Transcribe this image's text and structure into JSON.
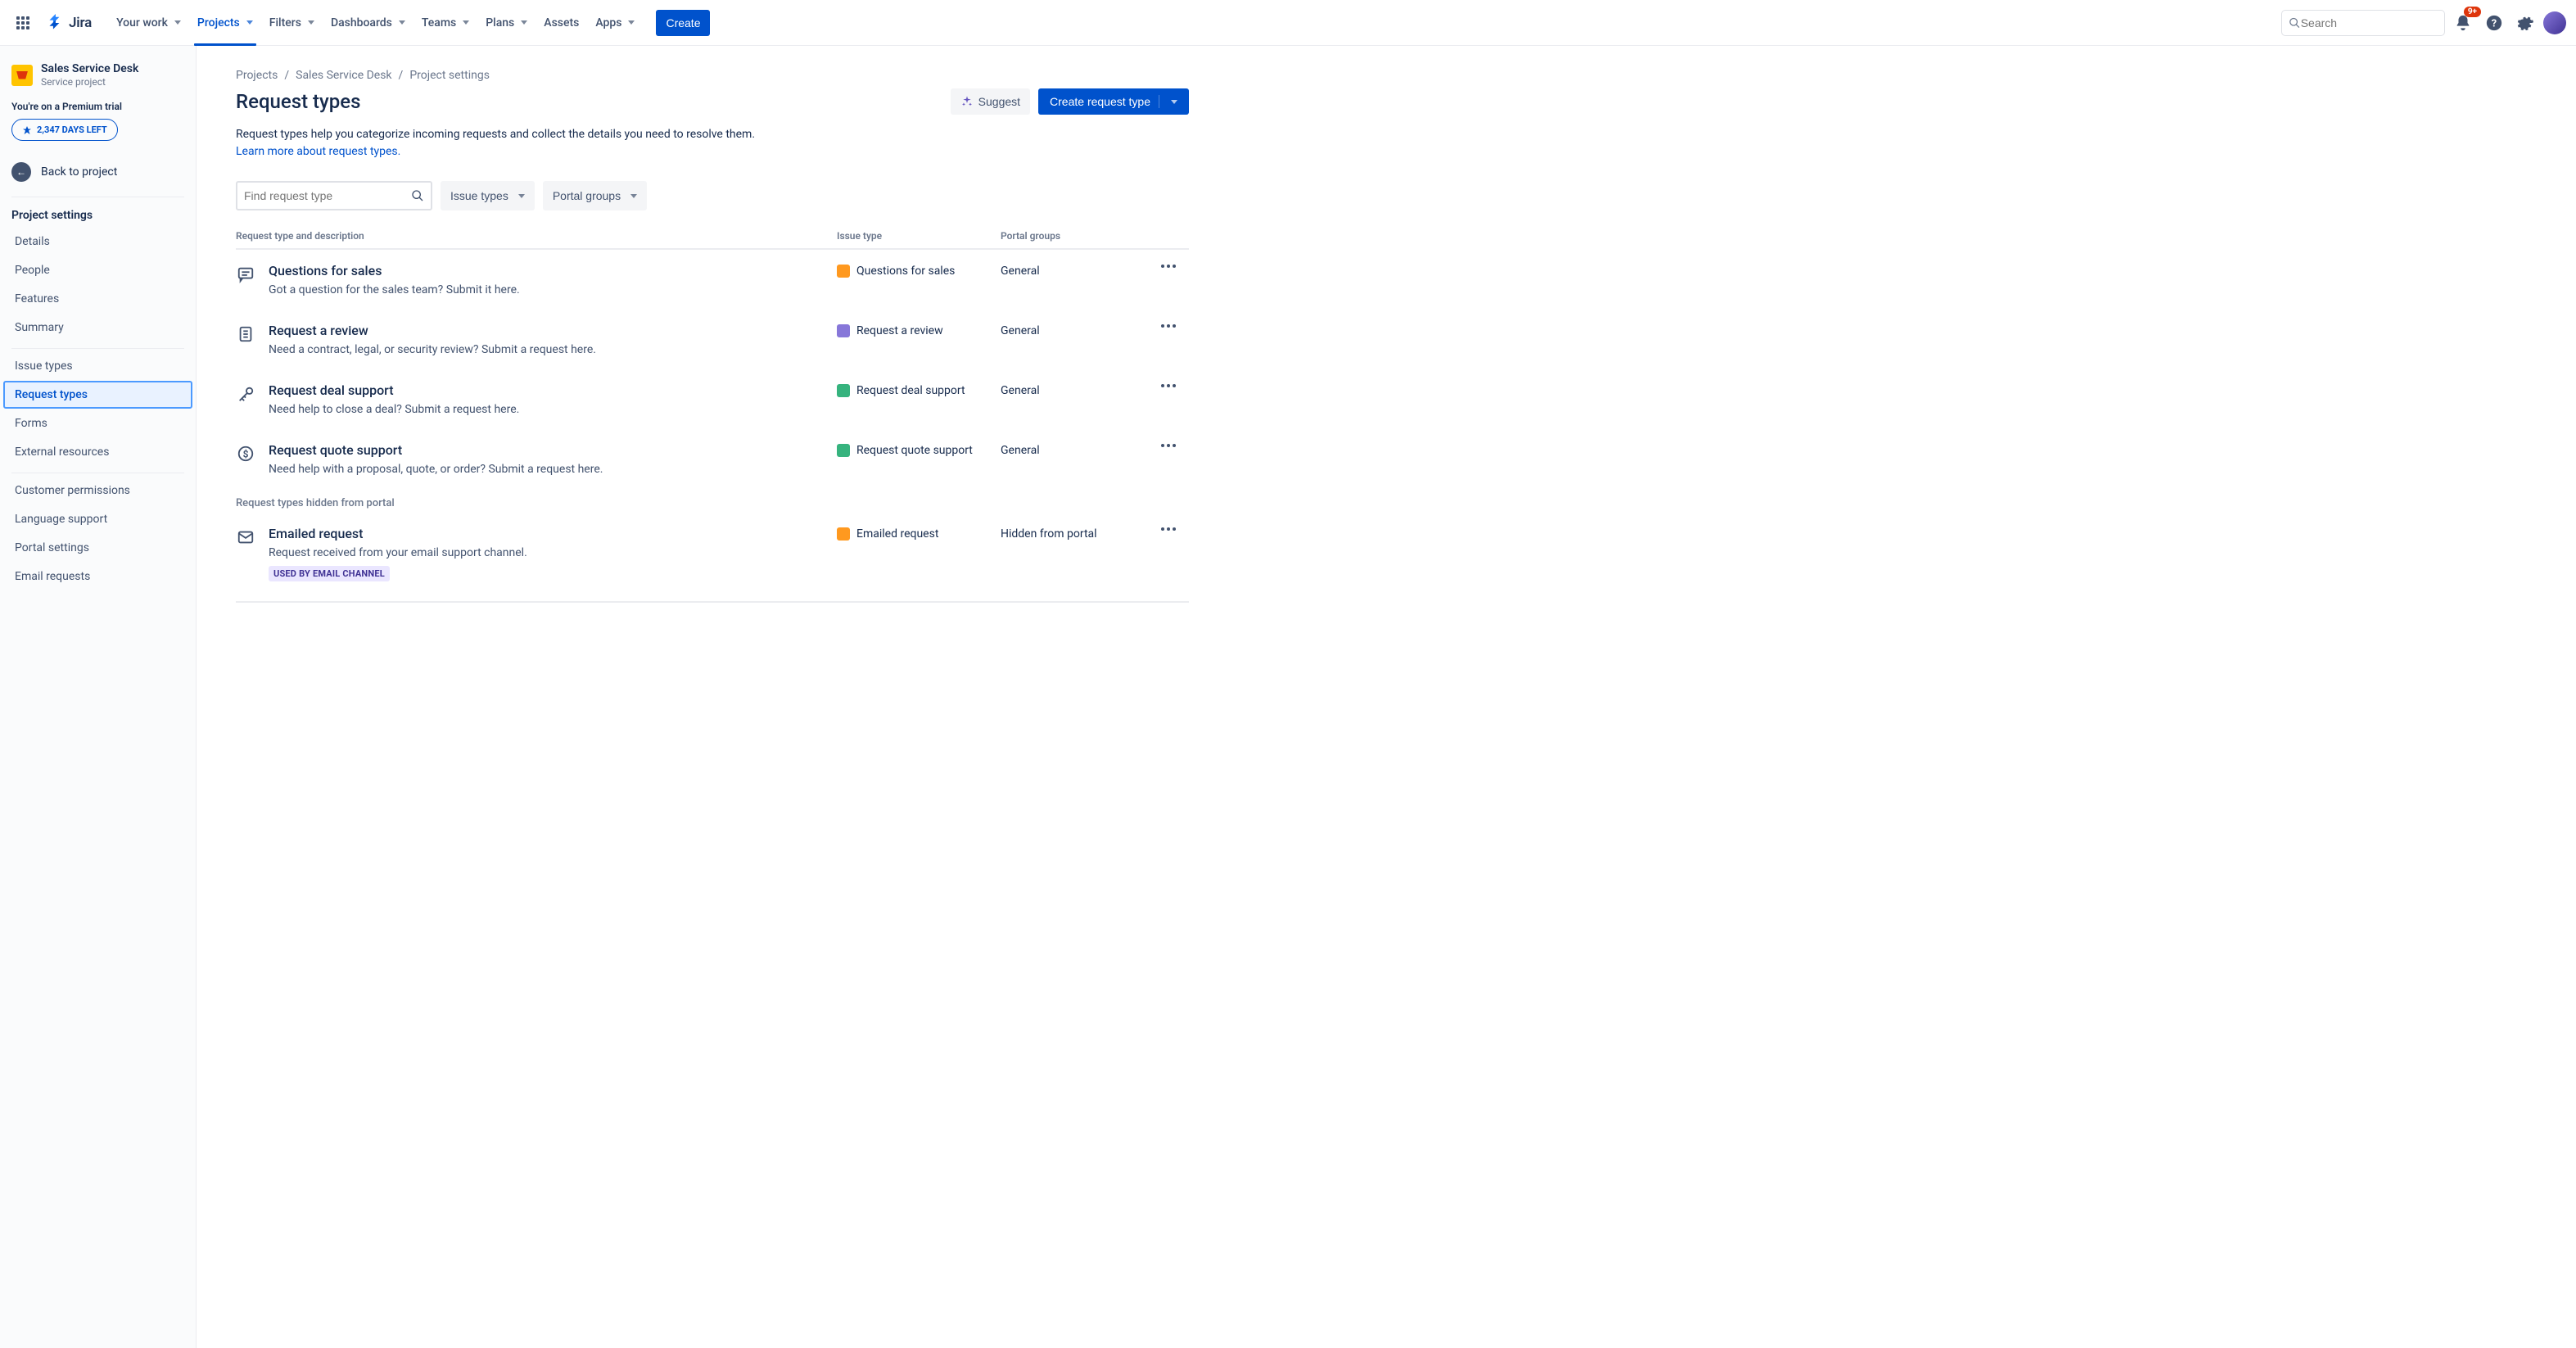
{
  "nav": {
    "logoText": "Jira",
    "items": [
      "Your work",
      "Projects",
      "Filters",
      "Dashboards",
      "Teams",
      "Plans",
      "Assets",
      "Apps"
    ],
    "activeIndex": 1,
    "hasDropdown": [
      true,
      true,
      true,
      true,
      true,
      true,
      false,
      true
    ],
    "createLabel": "Create",
    "searchPlaceholder": "Search",
    "notifBadge": "9+"
  },
  "sidebar": {
    "projectName": "Sales Service Desk",
    "projectType": "Service project",
    "trialLabel": "You're on a Premium trial",
    "trialDays": "2,347 DAYS LEFT",
    "backLabel": "Back to project",
    "sectionTitle": "Project settings",
    "groups": [
      [
        "Details",
        "People",
        "Features",
        "Summary"
      ],
      [
        "Issue types",
        "Request types",
        "Forms",
        "External resources"
      ],
      [
        "Customer permissions",
        "Language support",
        "Portal settings",
        "Email requests"
      ]
    ],
    "activeLink": "Request types"
  },
  "breadcrumbs": [
    "Projects",
    "Sales Service Desk",
    "Project settings"
  ],
  "page": {
    "title": "Request types",
    "suggestLabel": "Suggest",
    "createLabel": "Create request type",
    "desc": "Request types help you categorize incoming requests and collect the details you need to resolve them.",
    "learnLink": "Learn more about request types."
  },
  "filters": {
    "findPlaceholder": "Find request type",
    "issueTypes": "Issue types",
    "portalGroups": "Portal groups"
  },
  "table": {
    "headers": {
      "name": "Request type and description",
      "issue": "Issue type",
      "portal": "Portal groups"
    },
    "rows": [
      {
        "icon": "chat",
        "name": "Questions for sales",
        "desc": "Got a question for the sales team? Submit it here.",
        "issueBadgeColor": "#FF991F",
        "issueType": "Questions for sales",
        "portal": "General"
      },
      {
        "icon": "doc",
        "name": "Request a review",
        "desc": "Need a contract, legal, or security review? Submit a request here.",
        "issueBadgeColor": "#8777D9",
        "issueType": "Request a review",
        "portal": "General"
      },
      {
        "icon": "key",
        "name": "Request deal support",
        "desc": "Need help to close a deal? Submit a request here.",
        "issueBadgeColor": "#36B37E",
        "issueType": "Request deal support",
        "portal": "General"
      },
      {
        "icon": "dollar",
        "name": "Request quote support",
        "desc": "Need help with a proposal, quote, or order? Submit a request here.",
        "issueBadgeColor": "#36B37E",
        "issueType": "Request quote support",
        "portal": "General"
      }
    ],
    "hiddenLabel": "Request types hidden from portal",
    "hiddenRows": [
      {
        "icon": "mail",
        "name": "Emailed request",
        "desc": "Request received from your email support channel.",
        "tag": "USED BY EMAIL CHANNEL",
        "issueBadgeColor": "#FF991F",
        "issueType": "Emailed request",
        "portal": "Hidden from portal"
      }
    ]
  }
}
